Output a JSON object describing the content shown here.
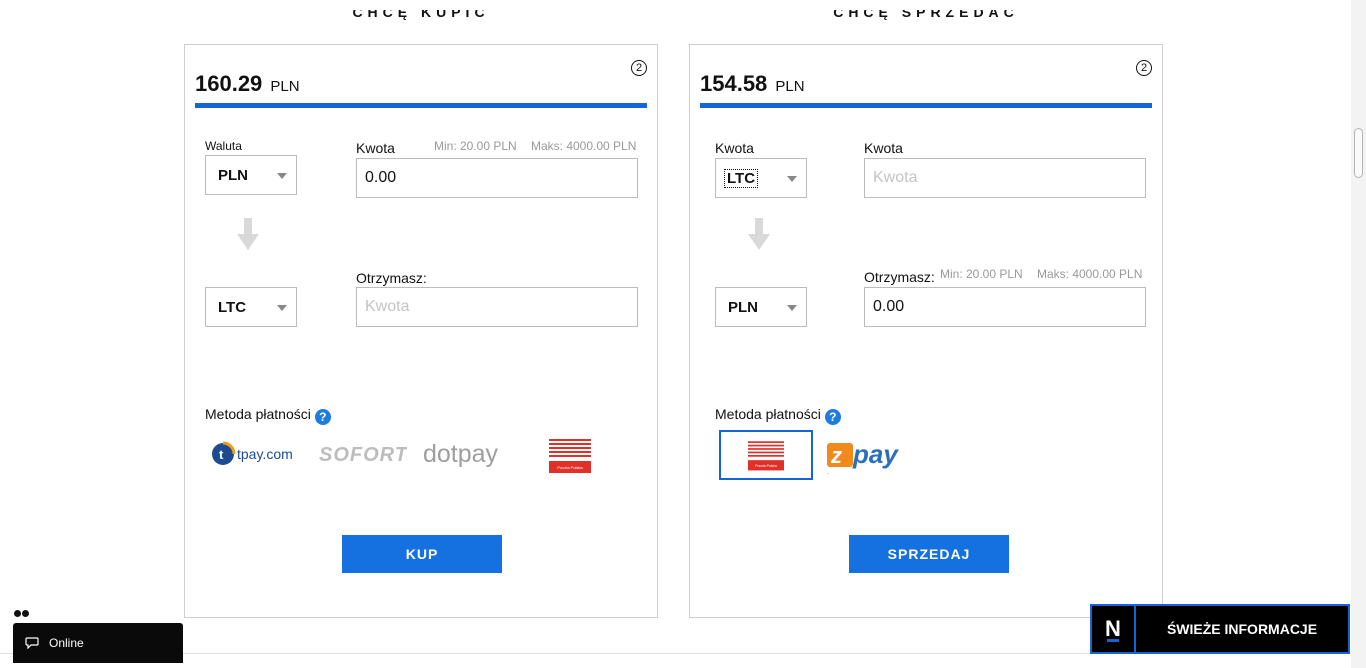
{
  "buy": {
    "heading": "CHCĘ KUPIĆ",
    "rate_value": "160.29",
    "rate_currency": "PLN",
    "step": "2",
    "from_label": "Waluta",
    "from_value": "PLN",
    "amount_label": "Kwota",
    "min_hint": "Min: 20.00 PLN",
    "max_hint": "Maks: 4000.00 PLN",
    "amount_value": "0.00",
    "to_value": "LTC",
    "receive_label": "Otrzymasz:",
    "receive_placeholder": "Kwota",
    "payment_label": "Metoda płatności",
    "help": "?",
    "payment_methods": [
      "tpay.com",
      "SOFORT",
      "dotpay",
      "Poczta Polska"
    ],
    "button": "KUP"
  },
  "sell": {
    "heading": "CHCĘ SPRZEDAĆ",
    "rate_value": "154.58",
    "rate_currency": "PLN",
    "step": "2",
    "from_label": "Kwota",
    "from_value": "LTC",
    "amount_label": "Kwota",
    "amount_placeholder": "Kwota",
    "to_value": "PLN",
    "receive_label": "Otrzymasz:",
    "min_hint": "Min: 20.00 PLN",
    "max_hint": "Maks: 4000.00 PLN",
    "receive_value": "0.00",
    "payment_label": "Metoda płatności",
    "help": "?",
    "payment_methods": [
      "Poczta Polska",
      "zpay"
    ],
    "button": "SPRZEDAJ"
  },
  "chat": {
    "status": "Online"
  },
  "news": {
    "logo": "N",
    "label": "ŚWIEŻE INFORMACJE"
  },
  "colors": {
    "accent": "#1565d8",
    "button": "#1570e0"
  }
}
